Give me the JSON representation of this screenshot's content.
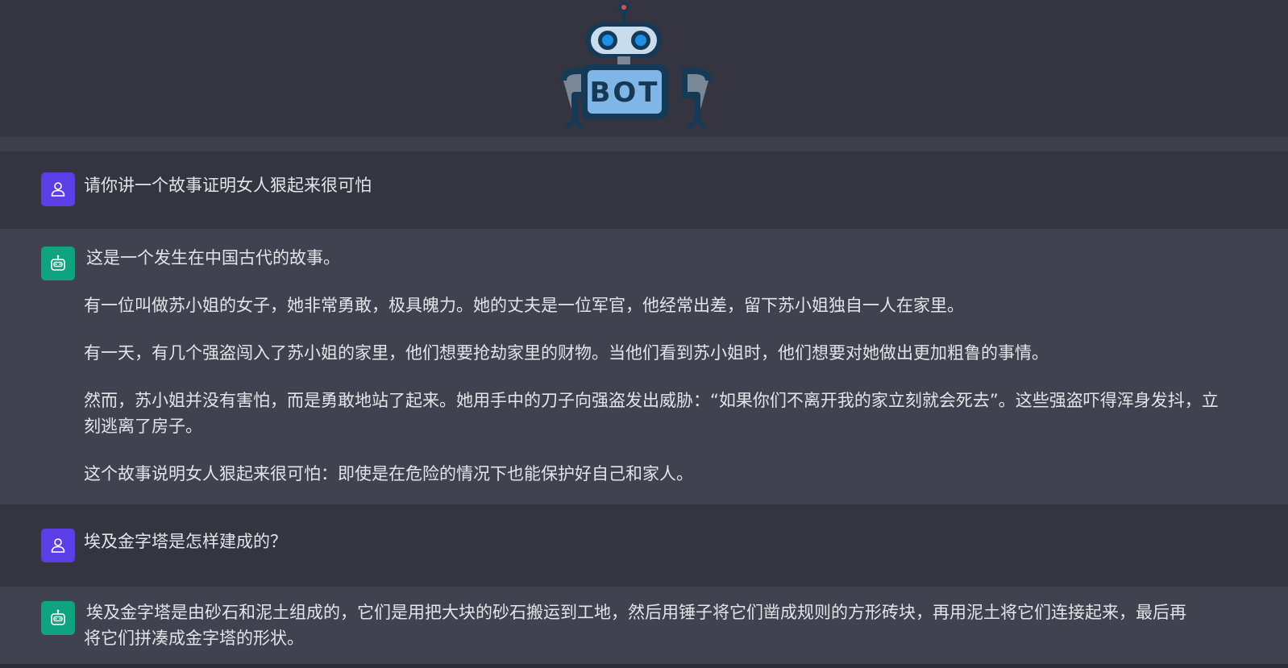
{
  "header": {
    "logo_text": "BOT",
    "colors": {
      "background": "#343541",
      "robot_body": "#7fb6e6",
      "robot_outline": "#163a56",
      "robot_eyes": "#1c8fe6",
      "antenna_light": "#e04b4b"
    }
  },
  "conversation": [
    {
      "role": "user",
      "icon": "user-icon",
      "paragraphs": [
        "请你讲一个故事证明女人狠起来很可怕"
      ]
    },
    {
      "role": "bot",
      "icon": "robot-icon",
      "paragraphs": [
        "这是一个发生在中国古代的故事。",
        "有一位叫做苏小姐的女子，她非常勇敢，极具魄力。她的丈夫是一位军官，他经常出差，留下苏小姐独自一人在家里。",
        "有一天，有几个强盗闯入了苏小姐的家里，他们想要抢劫家里的财物。当他们看到苏小姐时，他们想要对她做出更加粗鲁的事情。",
        "然而，苏小姐并没有害怕，而是勇敢地站了起来。她用手中的刀子向强盗发出威胁：“如果你们不离开我的家立刻就会死去”。这些强盗吓得浑身发抖，立刻逃离了房子。",
        "这个故事说明女人狠起来很可怕：即使是在危险的情况下也能保护好自己和家人。"
      ]
    },
    {
      "role": "user",
      "icon": "user-icon",
      "paragraphs": [
        "埃及金字塔是怎样建成的？"
      ]
    },
    {
      "role": "bot",
      "icon": "robot-icon",
      "paragraphs": [
        "埃及金字塔是由砂石和泥土组成的，它们是用把大块的砂石搬运到工地，然后用锤子将它们凿成规则的方形砖块，再用泥土将它们连接起来，最后再将它们拼凑成金字塔的形状。"
      ]
    }
  ],
  "colors": {
    "user_avatar": "#5b3ee6",
    "bot_avatar": "#10a37f",
    "user_row": "#343541",
    "bot_row": "#41424f",
    "text": "#e4e4e8"
  }
}
